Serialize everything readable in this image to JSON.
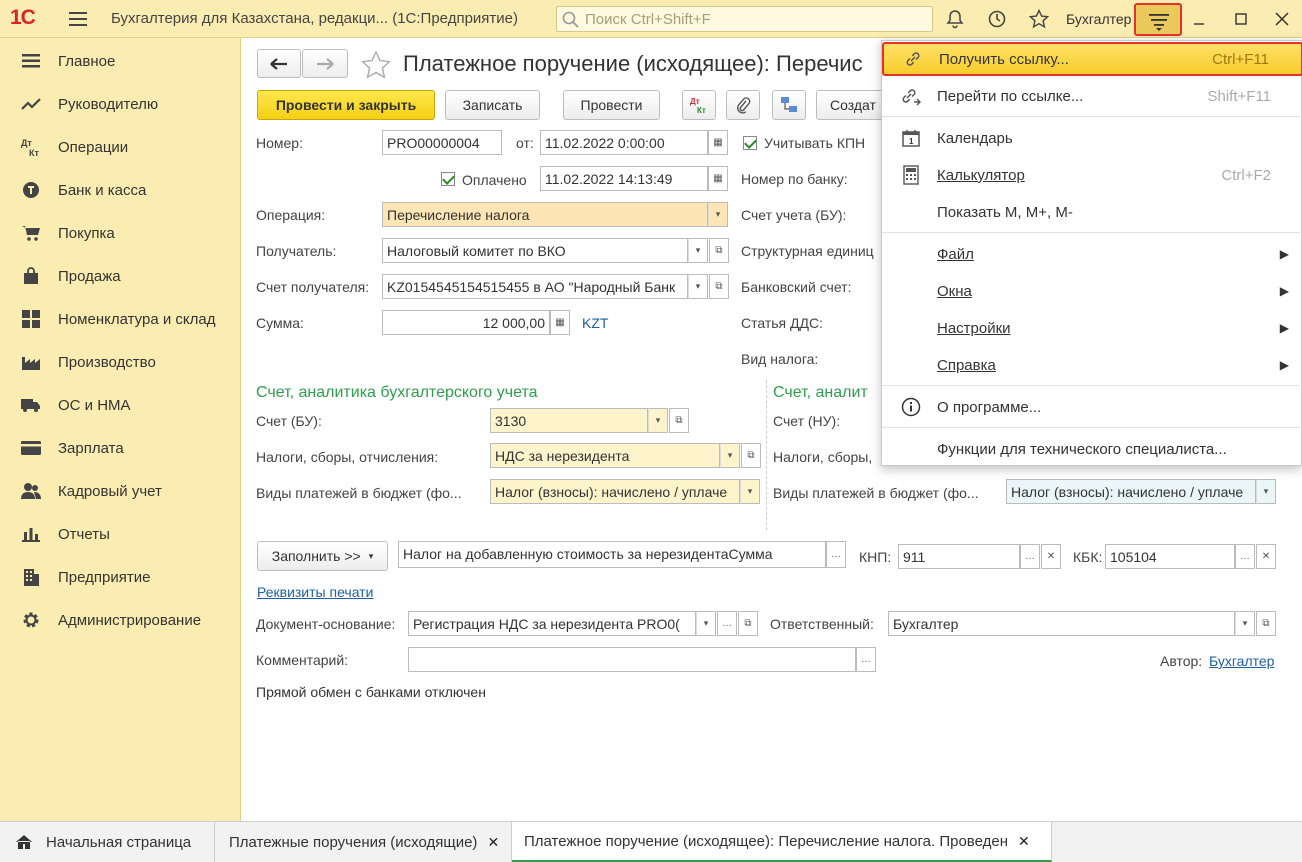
{
  "titlebar": {
    "logo": "1С",
    "app_title": "Бухгалтерия для Казахстана, редакци...  (1С:Предприятие)",
    "search_placeholder": "Поиск Ctrl+Shift+F",
    "user": "Бухгалтер"
  },
  "sidebar": {
    "items": [
      {
        "label": "Главное",
        "icon": "list-icon"
      },
      {
        "label": "Руководителю",
        "icon": "trend-icon"
      },
      {
        "label": "Операции",
        "icon": "dt-kt-icon"
      },
      {
        "label": "Банк и касса",
        "icon": "coin-icon"
      },
      {
        "label": "Покупка",
        "icon": "cart-icon"
      },
      {
        "label": "Продажа",
        "icon": "bag-icon"
      },
      {
        "label": "Номенклатура и склад",
        "icon": "grid-icon"
      },
      {
        "label": "Производство",
        "icon": "factory-icon"
      },
      {
        "label": "ОС и НМА",
        "icon": "truck-icon"
      },
      {
        "label": "Зарплата",
        "icon": "card-icon"
      },
      {
        "label": "Кадровый учет",
        "icon": "people-icon"
      },
      {
        "label": "Отчеты",
        "icon": "barchart-icon"
      },
      {
        "label": "Предприятие",
        "icon": "building-icon"
      },
      {
        "label": "Администрирование",
        "icon": "gear-icon"
      }
    ]
  },
  "form": {
    "title": "Платежное поручение (исходящее): Перечис",
    "buttons": {
      "post_close": "Провести и закрыть",
      "save": "Записать",
      "post": "Провести",
      "create": "Создат"
    },
    "number_label": "Номер:",
    "number_value": "PRO00000004",
    "date_label": "от:",
    "date_value": "11.02.2022  0:00:00",
    "kpn_label": "Учитывать КПН",
    "paid_label": "Оплачено",
    "paid_date": "11.02.2022 14:13:49",
    "bank_number_label": "Номер по банку:",
    "operation_label": "Операция:",
    "operation_value": "Перечисление налога",
    "account_bu_right_label": "Счет учета (БУ):",
    "recipient_label": "Получатель:",
    "recipient_value": "Налоговый комитет по ВКО",
    "struct_unit_label": "Структурная единиц",
    "recipient_account_label": "Счет получателя:",
    "recipient_account_value": "KZ0154545154515455 в АО \"Народный Банк",
    "bank_account_label": "Банковский счет:",
    "sum_label": "Сумма:",
    "sum_value": "12 000,00",
    "currency": "KZT",
    "dds_label": "Статья ДДС:",
    "tax_type_label": "Вид налога:",
    "section_bu": "Счет, аналитика бухгалтерского учета",
    "section_nu": "Счет, аналит",
    "acc_bu_label": "Счет (БУ):",
    "acc_bu_value": "3130",
    "acc_nu_label": "Счет (НУ):",
    "taxes_label": "Налоги, сборы, отчисления:",
    "taxes_value": "НДС за нерезидента",
    "taxes_label_nu": "Налоги, сборы,",
    "payments_label": "Виды платежей в бюджет (фо...",
    "payments_value": "Налог (взносы): начислено / уплаче",
    "payments_label_nu": "Виды платежей в бюджет (фо...",
    "payments_value_nu": "Налог (взносы): начислено / уплаче",
    "fill_button": "Заполнить >>",
    "purpose_value": "Налог на добавленную стоимость за нерезидентаСумма",
    "knp_label": "КНП:",
    "knp_value": "911",
    "kbk_label": "КБК:",
    "kbk_value": "105104",
    "print_details_link": "Реквизиты печати",
    "base_doc_label": "Документ-основание:",
    "base_doc_value": "Регистрация НДС за нерезидента PRO0(",
    "responsible_label": "Ответственный:",
    "responsible_value": "Бухгалтер",
    "comment_label": "Комментарий:",
    "author_label": "Автор:",
    "author_value": "Бухгалтер",
    "bank_exchange_status": "Прямой обмен с банками отключен"
  },
  "menu": {
    "items": [
      {
        "label": "Получить ссылку...",
        "shortcut": "Ctrl+F11",
        "icon": "link-icon"
      },
      {
        "label": "Перейти по ссылке...",
        "shortcut": "Shift+F11",
        "icon": "goto-link-icon"
      },
      {
        "label": "Календарь",
        "shortcut": "",
        "icon": "calendar-icon"
      },
      {
        "label": "Калькулятор",
        "shortcut": "Ctrl+F2",
        "icon": "calculator-icon"
      },
      {
        "label": "Показать М, М+, М-",
        "shortcut": "",
        "icon": ""
      },
      {
        "label": "Файл",
        "shortcut": "",
        "icon": ""
      },
      {
        "label": "Окна",
        "shortcut": "",
        "icon": ""
      },
      {
        "label": "Настройки",
        "shortcut": "",
        "icon": ""
      },
      {
        "label": "Справка",
        "shortcut": "",
        "icon": ""
      },
      {
        "label": "О программе...",
        "shortcut": "",
        "icon": "info-icon"
      },
      {
        "label": "Функции для технического специалиста...",
        "shortcut": "",
        "icon": ""
      }
    ]
  },
  "tabs": [
    {
      "label": "Начальная страница"
    },
    {
      "label": "Платежные поручения (исходящие)"
    },
    {
      "label": "Платежное поручение (исходящее): Перечисление налога. Проведен"
    }
  ],
  "colors": {
    "panel_bg": "#fbedb1",
    "accent_yellow": "#f5cf14",
    "section_green": "#2e9e4e",
    "link_blue": "#1f5ea8",
    "highlight_red": "#e5322d"
  }
}
